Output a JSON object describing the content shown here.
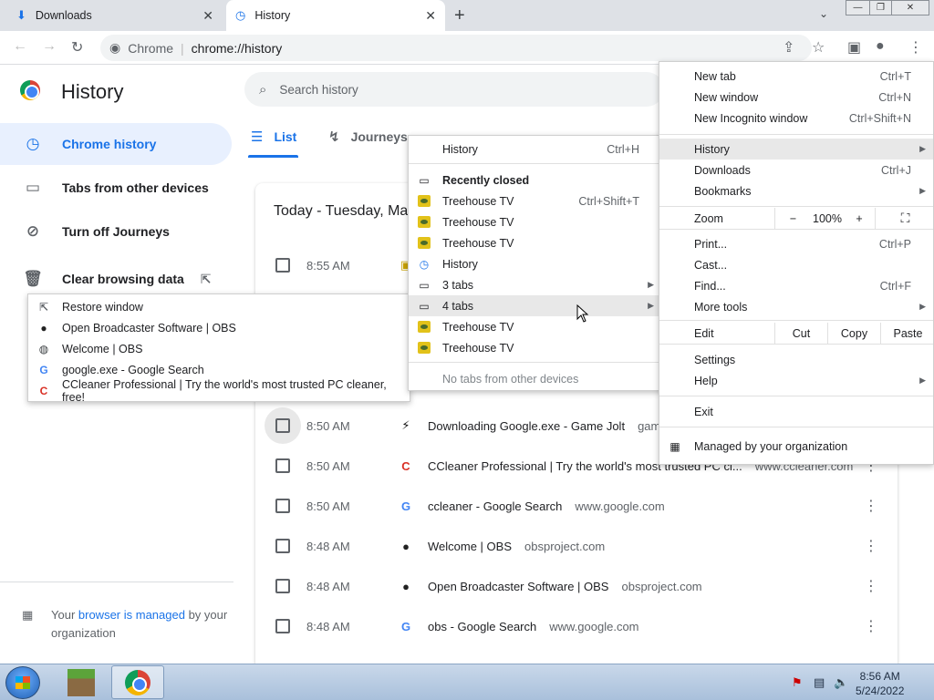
{
  "tabs": [
    {
      "title": "Downloads",
      "icon": "download-icon"
    },
    {
      "title": "History",
      "icon": "history-icon"
    }
  ],
  "omnibox": {
    "host": "Chrome",
    "path": "chrome://history"
  },
  "page": {
    "title": "History",
    "search_placeholder": "Search history",
    "sidebar": [
      {
        "label": "Chrome history",
        "icon": "clock-icon"
      },
      {
        "label": "Tabs from other devices",
        "icon": "devices-icon"
      },
      {
        "label": "Turn off Journeys",
        "icon": "journeys-off-icon"
      },
      {
        "label": "Clear browsing data",
        "icon": "trash-icon"
      }
    ],
    "managed_footer": {
      "pre": "Your ",
      "link": "browser is managed",
      "post": " by your organization"
    },
    "main_tabs": {
      "list": "List",
      "journeys": "Journeys"
    },
    "date_header": "Today - Tuesday, May 24, 2022",
    "rows": [
      {
        "time": "8:55 AM",
        "title": "",
        "domain": "",
        "favicon": "treehouse-tv-icon"
      },
      {
        "time": "8:50 AM",
        "title": "Downloading Google.exe - Game Jolt",
        "domain": "gamejolt.com",
        "favicon": "gamejolt-icon"
      },
      {
        "time": "8:50 AM",
        "title": "CCleaner Professional | Try the world's most trusted PC cl...",
        "domain": "www.ccleaner.com",
        "favicon": "ccleaner-icon"
      },
      {
        "time": "8:50 AM",
        "title": "ccleaner - Google Search",
        "domain": "www.google.com",
        "favicon": "google-icon"
      },
      {
        "time": "8:48 AM",
        "title": "Welcome | OBS",
        "domain": "obsproject.com",
        "favicon": "obs-icon"
      },
      {
        "time": "8:48 AM",
        "title": "Open Broadcaster Software | OBS",
        "domain": "obsproject.com",
        "favicon": "obs-icon"
      },
      {
        "time": "8:48 AM",
        "title": "obs - Google Search",
        "domain": "www.google.com",
        "favicon": "google-icon"
      }
    ]
  },
  "chrome_menu": {
    "new_tab": {
      "label": "New tab",
      "shortcut": "Ctrl+T"
    },
    "new_window": {
      "label": "New window",
      "shortcut": "Ctrl+N"
    },
    "new_incognito": {
      "label": "New Incognito window",
      "shortcut": "Ctrl+Shift+N"
    },
    "history": {
      "label": "History"
    },
    "downloads": {
      "label": "Downloads",
      "shortcut": "Ctrl+J"
    },
    "bookmarks": {
      "label": "Bookmarks"
    },
    "zoom": {
      "label": "Zoom",
      "minus": "−",
      "value": "100%",
      "plus": "+"
    },
    "print": {
      "label": "Print...",
      "shortcut": "Ctrl+P"
    },
    "cast": {
      "label": "Cast..."
    },
    "find": {
      "label": "Find...",
      "shortcut": "Ctrl+F"
    },
    "more_tools": {
      "label": "More tools"
    },
    "edit": {
      "label": "Edit",
      "cut": "Cut",
      "copy": "Copy",
      "paste": "Paste"
    },
    "settings": {
      "label": "Settings"
    },
    "help": {
      "label": "Help"
    },
    "exit": {
      "label": "Exit"
    },
    "managed": {
      "label": "Managed by your organization"
    }
  },
  "history_menu": {
    "history": {
      "label": "History",
      "shortcut": "Ctrl+H"
    },
    "recently_closed": "Recently closed",
    "items": [
      {
        "label": "Treehouse TV",
        "shortcut": "Ctrl+Shift+T",
        "type": "tv"
      },
      {
        "label": "Treehouse TV",
        "shortcut": "",
        "type": "tv"
      },
      {
        "label": "Treehouse TV",
        "shortcut": "",
        "type": "tv"
      },
      {
        "label": "History",
        "shortcut": "",
        "type": "history"
      },
      {
        "label": "3 tabs",
        "shortcut": "",
        "type": "window"
      },
      {
        "label": "4 tabs",
        "shortcut": "",
        "type": "window"
      },
      {
        "label": "Treehouse TV",
        "shortcut": "",
        "type": "tv"
      },
      {
        "label": "Treehouse TV",
        "shortcut": "",
        "type": "tv"
      }
    ],
    "no_tabs": "No tabs from other devices"
  },
  "restore_menu": {
    "items": [
      {
        "label": "Restore window",
        "icon": "open-external-icon"
      },
      {
        "label": "Open Broadcaster Software | OBS",
        "icon": "obs-icon"
      },
      {
        "label": "Welcome | OBS",
        "icon": "globe-icon"
      },
      {
        "label": "google.exe - Google Search",
        "icon": "google-icon"
      },
      {
        "label": "CCleaner Professional | Try the world's most trusted PC cleaner, free!",
        "icon": "ccleaner-icon"
      }
    ]
  },
  "taskbar": {
    "time": "8:56 AM",
    "date": "5/24/2022"
  },
  "colors": {
    "accent": "#1a73e8",
    "active_bg": "#e8f0fe",
    "tabstrip": "#dee1e6"
  }
}
